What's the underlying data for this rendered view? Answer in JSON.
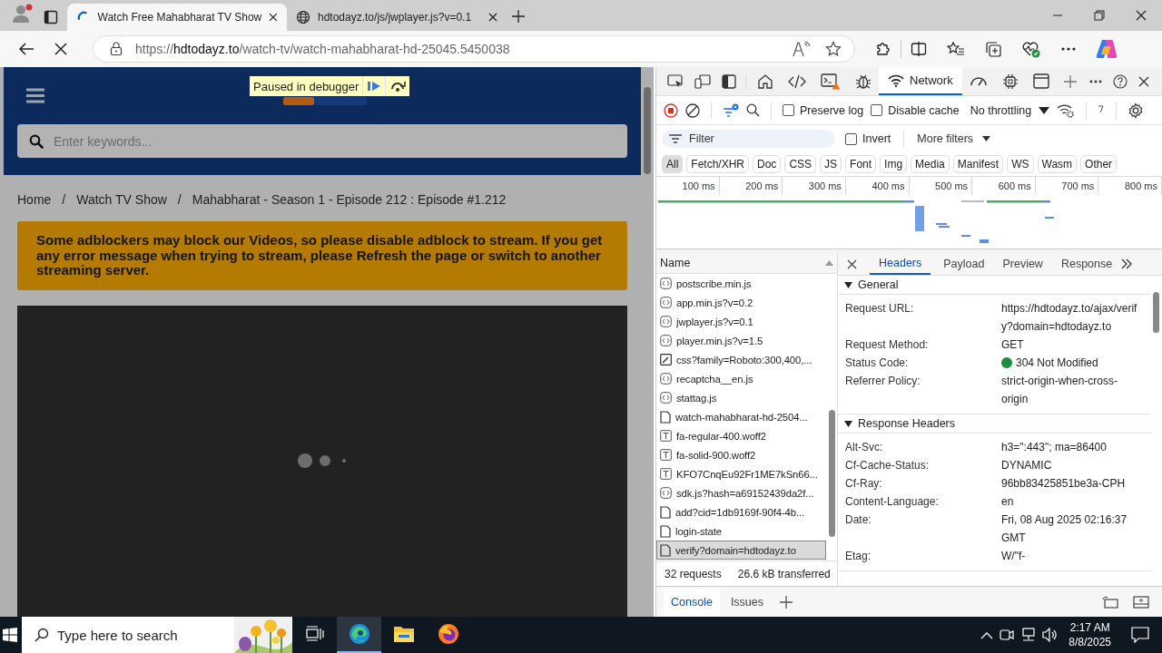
{
  "browser": {
    "tabs": [
      {
        "title": "Watch Free Mahabharat TV Show",
        "loading": true,
        "selected": true
      },
      {
        "title": "hdtodayz.to/js/jwplayer.js?v=0.1",
        "loading": false,
        "selected": false
      }
    ],
    "address": {
      "scheme": "https://",
      "host": "hdtodayz.to",
      "path": "/watch-tv/watch-mahabharat-hd-25045.5450038"
    }
  },
  "page": {
    "debugger_badge": "Paused in debugger",
    "search_placeholder": "Enter keywords...",
    "breadcrumb": [
      {
        "label": "Home",
        "separator": "/"
      },
      {
        "label": "Watch TV Show",
        "separator": "/"
      },
      {
        "label": "Mahabharat - Season 1 - Episode 212 : Episode #1.212"
      }
    ],
    "notice": "Some adblockers may block our Videos, so please disable adblock to stream. If you get any error message when trying to stream, please Refresh the page or switch to another streaming server.",
    "player": {
      "loading": true
    }
  },
  "devtools": {
    "tool_tabs": [
      {
        "selected": false
      },
      {
        "selected": false
      },
      {
        "selected": false
      },
      {
        "selected": false
      },
      {
        "label": "Network",
        "selected": true
      },
      {
        "selected": false
      },
      {
        "selected": false
      },
      {
        "selected": false
      }
    ],
    "preserve_log": {
      "label": "Preserve log",
      "checked": false
    },
    "disable_cache": {
      "label": "Disable cache",
      "checked": false
    },
    "throttling": "No throttling",
    "filter_placeholder": "Filter",
    "invert": {
      "label": "Invert",
      "checked": false
    },
    "more_filters": "More filters",
    "type_filters": [
      {
        "label": "All",
        "selected": true
      },
      {
        "label": "Fetch/XHR",
        "selected": false
      },
      {
        "label": "Doc",
        "selected": false
      },
      {
        "label": "CSS",
        "selected": false
      },
      {
        "label": "JS",
        "selected": false
      },
      {
        "label": "Font",
        "selected": false
      },
      {
        "label": "Img",
        "selected": false
      },
      {
        "label": "Media",
        "selected": false
      },
      {
        "label": "Manifest",
        "selected": false
      },
      {
        "label": "WS",
        "selected": false
      },
      {
        "label": "Wasm",
        "selected": false
      },
      {
        "label": "Other",
        "selected": false
      }
    ],
    "overview_ticks": [
      "100 ms",
      "200 ms",
      "300 ms",
      "400 ms",
      "500 ms",
      "600 ms",
      "700 ms",
      "800 ms"
    ],
    "name_header": "Name",
    "requests": [
      {
        "name": "postscribe.min.js",
        "kind": "script",
        "selected": false
      },
      {
        "name": "app.min.js?v=0.2",
        "kind": "script",
        "selected": false
      },
      {
        "name": "jwplayer.js?v=0.1",
        "kind": "script",
        "selected": false
      },
      {
        "name": "player.min.js?v=1.5",
        "kind": "script",
        "selected": false
      },
      {
        "name": "css?family=Roboto:300,400,...",
        "kind": "stylesheet",
        "selected": false
      },
      {
        "name": "recaptcha__en.js",
        "kind": "script",
        "selected": false
      },
      {
        "name": "stattag.js",
        "kind": "script",
        "selected": false
      },
      {
        "name": "watch-mahabharat-hd-2504...",
        "kind": "document",
        "selected": false
      },
      {
        "name": "fa-regular-400.woff2",
        "kind": "font",
        "selected": false
      },
      {
        "name": "fa-solid-900.woff2",
        "kind": "font",
        "selected": false
      },
      {
        "name": "KFO7CnqEu92Fr1ME7kSn66...",
        "kind": "font",
        "selected": false
      },
      {
        "name": "sdk.js?hash=a69152439da2f...",
        "kind": "script",
        "selected": false
      },
      {
        "name": "add?cid=1db9169f-90f4-4b...",
        "kind": "document",
        "selected": false
      },
      {
        "name": "login-state",
        "kind": "document",
        "selected": false
      },
      {
        "name": "verify?domain=hdtodayz.to",
        "kind": "document",
        "selected": true
      }
    ],
    "summary": [
      "32 requests",
      "26.6 kB transferred"
    ],
    "detail_tabs": [
      {
        "label": "Headers",
        "selected": true
      },
      {
        "label": "Payload",
        "selected": false
      },
      {
        "label": "Preview",
        "selected": false
      },
      {
        "label": "Response",
        "selected": false
      }
    ],
    "sections": [
      {
        "title": "General",
        "expanded": true,
        "rows": [
          {
            "key": "Request URL:",
            "value": "https://hdtodayz.to/ajax/verify?domain=hdtodayz.to"
          },
          {
            "key": "Request Method:",
            "value": "GET"
          },
          {
            "key": "Status Code:",
            "value": "304 Not Modified",
            "color": "#1e8e3e"
          },
          {
            "key": "Referrer Policy:",
            "value": "strict-origin-when-cross-origin"
          }
        ]
      },
      {
        "title": "Response Headers",
        "expanded": true,
        "rows": [
          {
            "key": "Alt-Svc:",
            "value": "h3=\":443\"; ma=86400"
          },
          {
            "key": "Cf-Cache-Status:",
            "value": "DYNAMIC"
          },
          {
            "key": "Cf-Ray:",
            "value": "96bb83425851be3a-CPH"
          },
          {
            "key": "Content-Language:",
            "value": "en"
          },
          {
            "key": "Date:",
            "value": "Fri, 08 Aug 2025 02:16:37 GMT"
          },
          {
            "key": "Etag:",
            "value": "W/\"f-"
          }
        ]
      }
    ],
    "drawer_tabs": [
      {
        "label": "Console",
        "selected": true
      },
      {
        "label": "Issues",
        "selected": false
      }
    ]
  },
  "taskbar": {
    "search_placeholder": "Type here to search",
    "apps": [
      {
        "selected": false
      },
      {
        "selected": true
      },
      {
        "selected": false
      },
      {
        "selected": false
      }
    ],
    "time": "2:17 AM",
    "date": "8/8/2025"
  }
}
